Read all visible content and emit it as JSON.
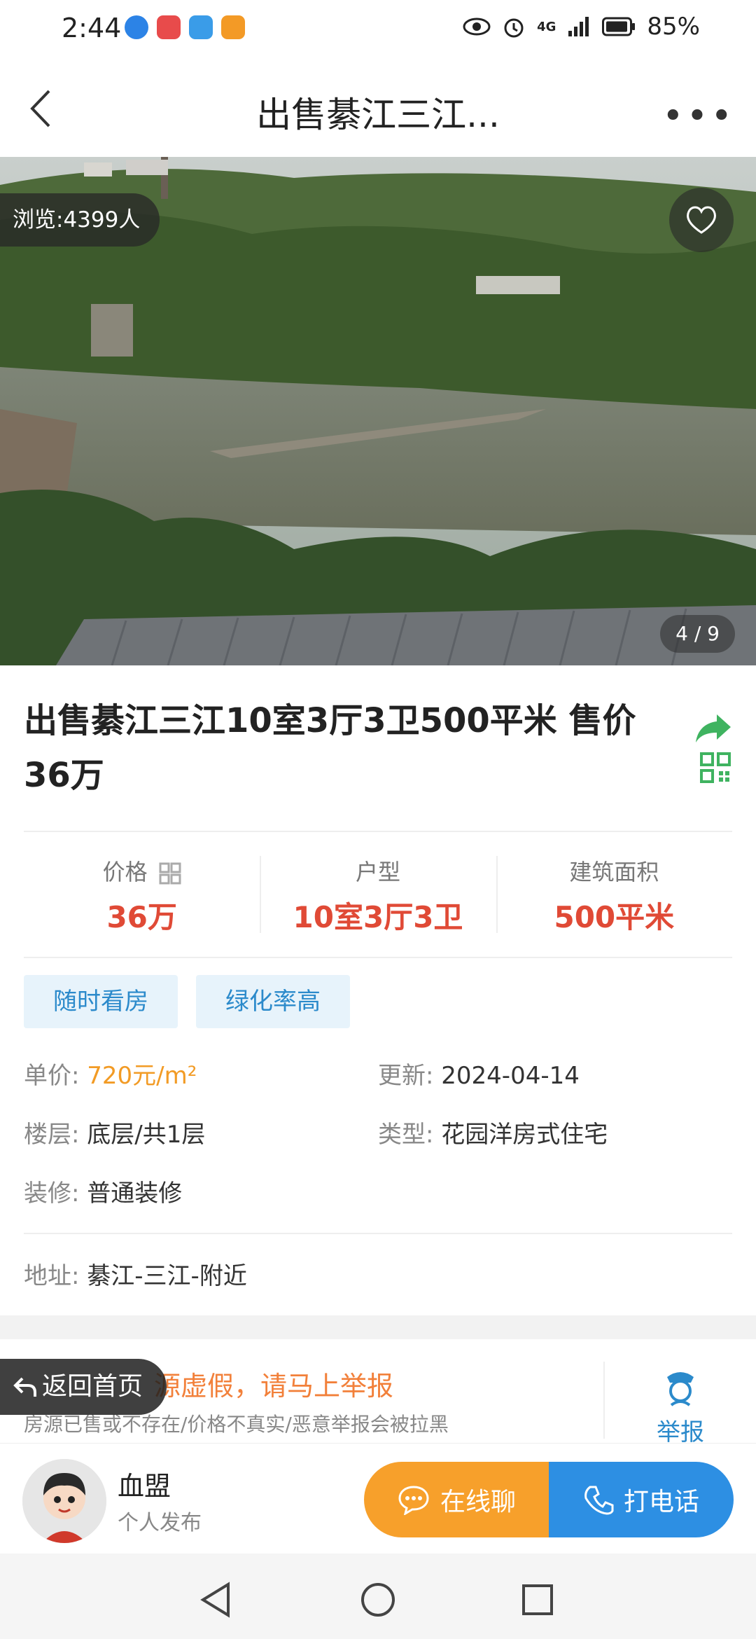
{
  "status_bar": {
    "time": "2:44",
    "network": "4G",
    "battery": "85%",
    "icons": [
      "globe-icon",
      "huawei-app-icon",
      "cloud-icon",
      "video-icon",
      "eye-icon",
      "alarm-icon",
      "signal-icon",
      "battery-icon"
    ]
  },
  "nav": {
    "title": "出售綦江三江...",
    "back_icon": "chevron-left-icon",
    "more_icon": "more-dots-icon"
  },
  "gallery": {
    "views": "浏览:4399人",
    "counter": "4 / 9",
    "favorite_icon": "heart-icon"
  },
  "listing": {
    "title": "出售綦江三江10室3厅3卫500平米 售价36万",
    "share_icon": "share-arrow-icon",
    "qr_icon": "qr-code-icon"
  },
  "stats": [
    {
      "label": "价格",
      "value": "36万"
    },
    {
      "label": "户型",
      "value": "10室3厅3卫"
    },
    {
      "label": "建筑面积",
      "value": "500平米"
    }
  ],
  "tags": [
    "随时看房",
    "绿化率高"
  ],
  "details": {
    "unit_price_label": "单价:",
    "unit_price_value": "720元/m²",
    "updated_label": "更新:",
    "updated_value": "2024-04-14",
    "floor_label": "楼层:",
    "floor_value": "底层/共1层",
    "type_label": "类型:",
    "type_value": "花园洋房式住宅",
    "decoration_label": "装修:",
    "decoration_value": "普通装修",
    "address_label": "地址:",
    "address_value": "綦江-三江-附近"
  },
  "report": {
    "title": "源虚假，请马上举报",
    "subtitle": "房源已售或不存在/价格不真实/恶意举报会被拉黑",
    "button": "举报"
  },
  "home_button": "返回首页",
  "seller": {
    "name": "血盟",
    "type": "个人发布"
  },
  "actions": {
    "chat": "在线聊",
    "call": "打电话"
  },
  "colors": {
    "price_red": "#e04a36",
    "unit_price_orange": "#f29b25",
    "tag_blue": "#2b8acb",
    "chat_orange": "#f7a02b",
    "call_blue": "#2d8fe3",
    "share_green": "#3fb360"
  }
}
